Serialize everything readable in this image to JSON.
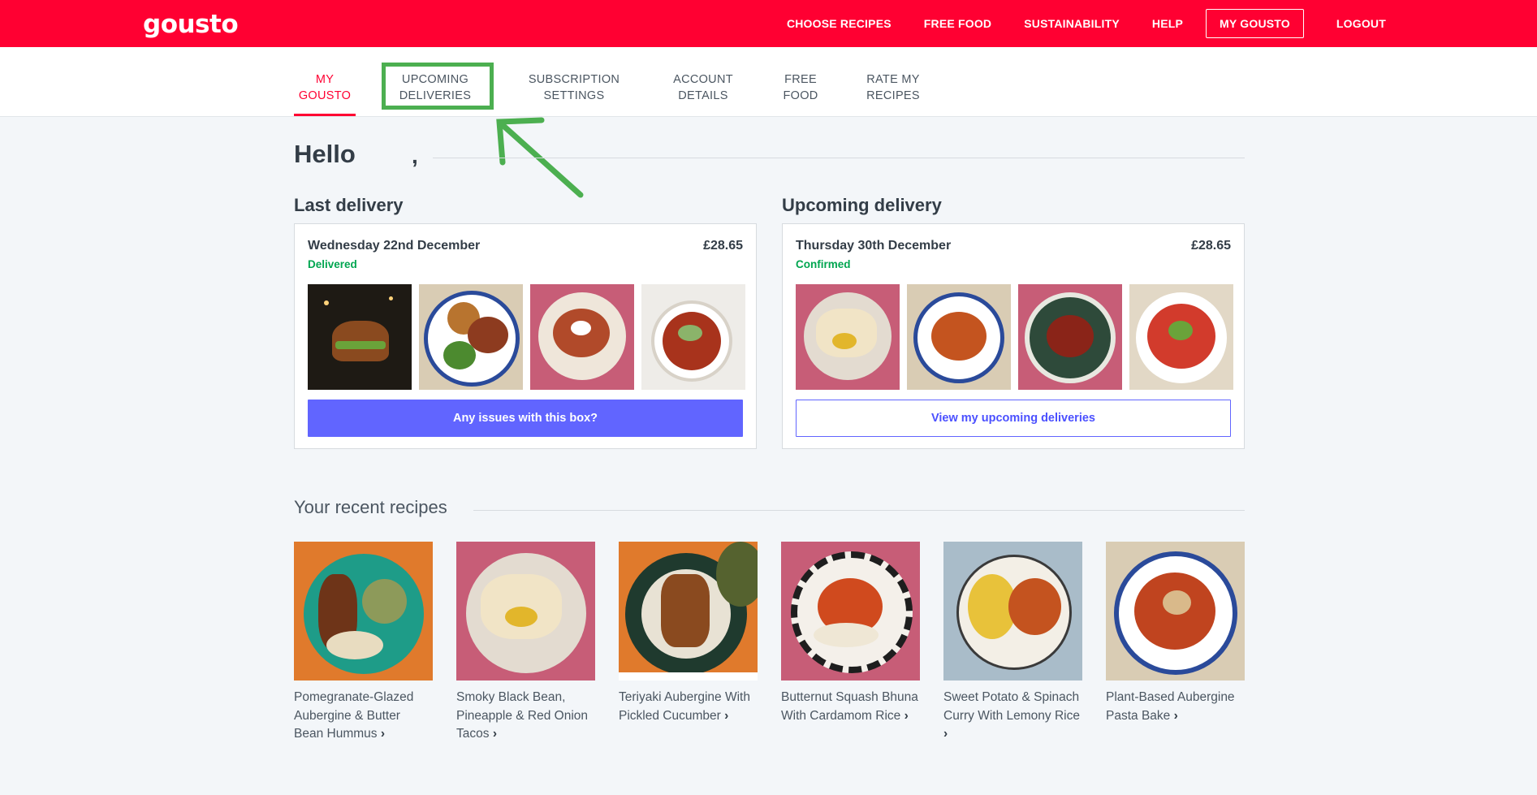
{
  "header": {
    "logo": "gousto",
    "nav": [
      "CHOOSE RECIPES",
      "FREE FOOD",
      "SUSTAINABILITY",
      "HELP"
    ],
    "my_gousto": "MY GOUSTO",
    "logout": "LOGOUT"
  },
  "subnav": {
    "tabs": [
      {
        "line1": "MY",
        "line2": "GOUSTO"
      },
      {
        "line1": "UPCOMING",
        "line2": "DELIVERIES"
      },
      {
        "line1": "SUBSCRIPTION",
        "line2": "SETTINGS"
      },
      {
        "line1": "ACCOUNT",
        "line2": "DETAILS"
      },
      {
        "line1": "FREE",
        "line2": "FOOD"
      },
      {
        "line1": "RATE MY",
        "line2": "RECIPES"
      }
    ]
  },
  "greeting": {
    "hello": "Hello",
    "comma": ","
  },
  "last_delivery": {
    "title": "Last delivery",
    "date": "Wednesday 22nd December",
    "price": "£28.65",
    "status": "Delivered",
    "button": "Any issues with this box?"
  },
  "upcoming_delivery": {
    "title": "Upcoming delivery",
    "date": "Thursday 30th December",
    "price": "£28.65",
    "status": "Confirmed",
    "button": "View my upcoming deliveries"
  },
  "recent": {
    "title": "Your recent recipes",
    "recipes": [
      {
        "name": "Pomegranate-Glazed Aubergine & Butter Bean Hummus"
      },
      {
        "name": "Smoky Black Bean, Pineapple & Red Onion Tacos"
      },
      {
        "name": "Teriyaki Aubergine With Pickled Cucumber"
      },
      {
        "name": "Butternut Squash Bhuna With Cardamom Rice"
      },
      {
        "name": "Sweet Potato & Spinach Curry With Lemony Rice"
      },
      {
        "name": "Plant-Based Aubergine Pasta Bake"
      }
    ]
  },
  "colors": {
    "brand_red": "#ff0032",
    "button_purple": "#6165ff",
    "status_green": "#00a650",
    "annotation_green": "#4caf50"
  }
}
